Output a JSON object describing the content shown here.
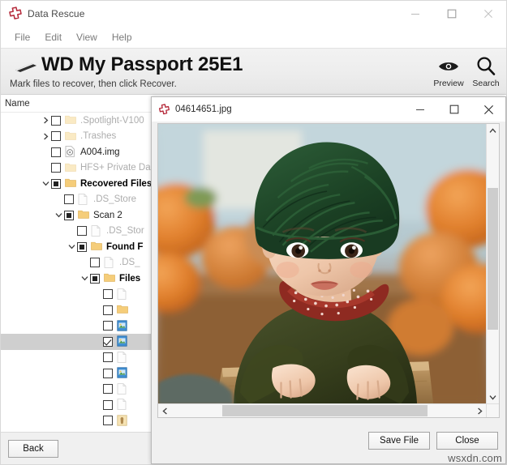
{
  "app": {
    "title": "Data Rescue",
    "logo_icon": "data-rescue-cross-icon",
    "window_controls": {
      "minimize": "minimize-icon",
      "maximize": "maximize-icon",
      "close": "close-icon"
    }
  },
  "menubar": {
    "items": [
      {
        "label": "File"
      },
      {
        "label": "Edit"
      },
      {
        "label": "View"
      },
      {
        "label": "Help"
      }
    ]
  },
  "header": {
    "drive_icon": "hard-drive-icon",
    "device_title": "WD My Passport 25E1",
    "subtitle": "Mark files to recover, then click Recover.",
    "actions": [
      {
        "name": "preview",
        "label": "Preview",
        "icon": "eye-icon"
      },
      {
        "name": "search",
        "label": "Search",
        "icon": "magnifier-icon"
      }
    ]
  },
  "file_tree": {
    "column_header": "Name",
    "rows": [
      {
        "label": ".Spotlight-V100",
        "indent": 2,
        "twisty": "collapsed",
        "check": "unchecked",
        "icon": "folder-dim-icon",
        "style": "dim",
        "selected": false
      },
      {
        "label": ".Trashes",
        "indent": 2,
        "twisty": "collapsed",
        "check": "unchecked",
        "icon": "folder-dim-icon",
        "style": "dim",
        "selected": false
      },
      {
        "label": "A004.img",
        "indent": 2,
        "twisty": "none",
        "check": "unchecked",
        "icon": "disk-image-icon",
        "style": "normal",
        "selected": false
      },
      {
        "label": "HFS+ Private Da",
        "indent": 2,
        "twisty": "none",
        "check": "unchecked",
        "icon": "folder-dim-icon",
        "style": "dim",
        "selected": false
      },
      {
        "label": "Recovered Files",
        "indent": 2,
        "twisty": "expanded",
        "check": "partial",
        "icon": "folder-icon",
        "style": "bold",
        "selected": false
      },
      {
        "label": ".DS_Store",
        "indent": 3,
        "twisty": "none",
        "check": "unchecked",
        "icon": "file-dim-icon",
        "style": "dim",
        "selected": false
      },
      {
        "label": "Scan 2",
        "indent": 3,
        "twisty": "expanded",
        "check": "partial",
        "icon": "folder-icon",
        "style": "normal",
        "selected": false
      },
      {
        "label": ".DS_Stor",
        "indent": 4,
        "twisty": "none",
        "check": "unchecked",
        "icon": "file-dim-icon",
        "style": "dim",
        "selected": false
      },
      {
        "label": "Found F",
        "indent": 4,
        "twisty": "expanded",
        "check": "partial",
        "icon": "folder-icon",
        "style": "bold",
        "selected": false
      },
      {
        "label": ".DS_",
        "indent": 5,
        "twisty": "none",
        "check": "unchecked",
        "icon": "file-dim-icon",
        "style": "dim",
        "selected": false
      },
      {
        "label": "Files",
        "indent": 5,
        "twisty": "expanded",
        "check": "partial",
        "icon": "folder-icon",
        "style": "bold",
        "selected": false
      },
      {
        "label": "",
        "indent": 6,
        "twisty": "none",
        "check": "unchecked",
        "icon": "file-dim-icon",
        "style": "dim",
        "selected": false
      },
      {
        "label": "",
        "indent": 6,
        "twisty": "none",
        "check": "unchecked",
        "icon": "folder-icon",
        "style": "normal",
        "selected": false
      },
      {
        "label": "",
        "indent": 6,
        "twisty": "none",
        "check": "unchecked",
        "icon": "image-file-icon",
        "style": "normal",
        "selected": false
      },
      {
        "label": "",
        "indent": 6,
        "twisty": "none",
        "check": "checked",
        "icon": "image-file-icon",
        "style": "normal",
        "selected": true
      },
      {
        "label": "",
        "indent": 6,
        "twisty": "none",
        "check": "unchecked",
        "icon": "file-dim-icon",
        "style": "dim",
        "selected": false
      },
      {
        "label": "",
        "indent": 6,
        "twisty": "none",
        "check": "unchecked",
        "icon": "image-file-icon",
        "style": "normal",
        "selected": false
      },
      {
        "label": "",
        "indent": 6,
        "twisty": "none",
        "check": "unchecked",
        "icon": "file-dim-icon",
        "style": "dim",
        "selected": false
      },
      {
        "label": "",
        "indent": 6,
        "twisty": "none",
        "check": "unchecked",
        "icon": "file-dim-icon",
        "style": "dim",
        "selected": false
      },
      {
        "label": "",
        "indent": 6,
        "twisty": "none",
        "check": "unchecked",
        "icon": "app-file-icon",
        "style": "normal",
        "selected": false
      }
    ]
  },
  "bottom_bar": {
    "back_label": "Back"
  },
  "preview_dialog": {
    "title": "04614651.jpg",
    "logo_icon": "data-rescue-cross-icon",
    "window_controls": {
      "minimize": "minimize-icon",
      "maximize": "maximize-icon",
      "close": "close-icon"
    },
    "image": {
      "alt": "Baby wearing dark green knit hat and olive shirt with red polka-dot scarf, leaning on wooden board, pumpkins in background",
      "colors": {
        "hat_green": "#1e4429",
        "shirt_olive": "#39421f",
        "scarf_red": "#8e2a21",
        "pumpkin_orange": "#e0792a",
        "wood_brown": "#9c7145",
        "background_blue": "#b9ccd2",
        "skin": "#f1cdb4"
      }
    },
    "scrollbars": {
      "vertical_up": "chevron-up-icon",
      "vertical_down": "chevron-down-icon",
      "horizontal_left": "chevron-left-icon",
      "horizontal_right": "chevron-right-icon"
    },
    "buttons": {
      "save_file": "Save File",
      "close": "Close"
    }
  },
  "watermark": "wsxdn.com"
}
